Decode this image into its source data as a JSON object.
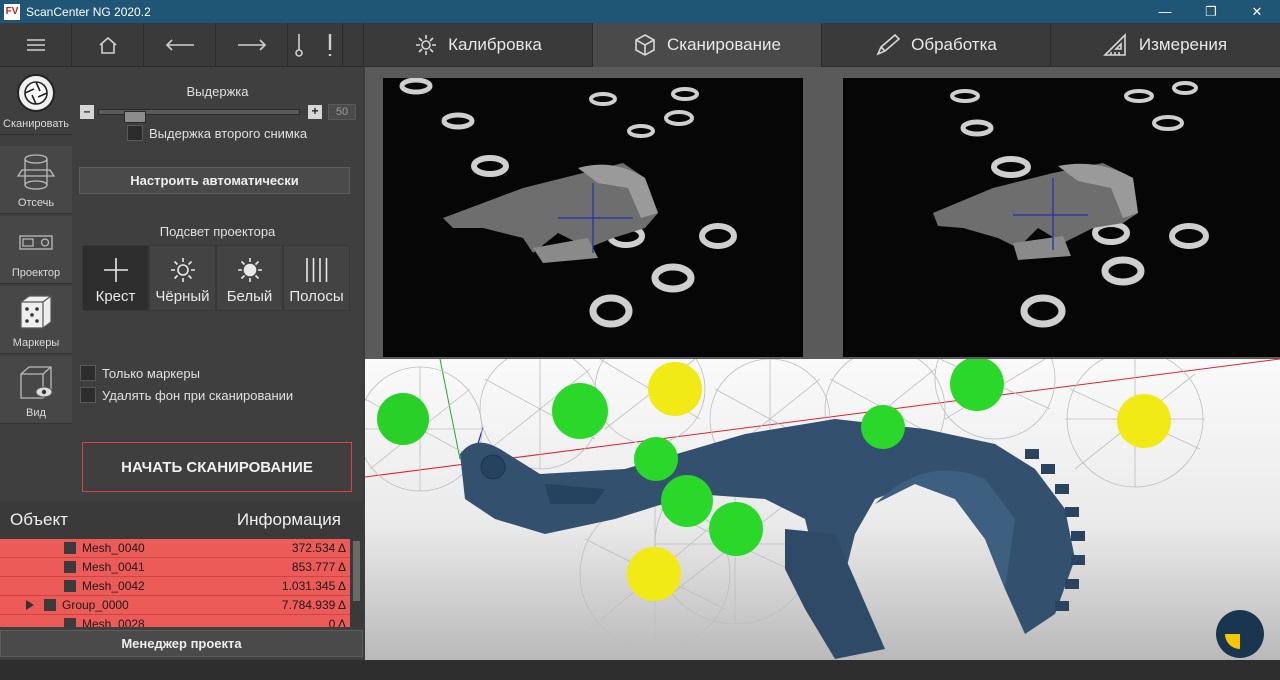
{
  "app": {
    "title": "ScanCenter NG 2020.2",
    "logo": "FV"
  },
  "window": {
    "minimize": "—",
    "restore": "❐",
    "close": "✕"
  },
  "tabs": [
    {
      "label": "Калибровка"
    },
    {
      "label": "Сканирование"
    },
    {
      "label": "Обработка"
    },
    {
      "label": "Измерения"
    }
  ],
  "sidebar": {
    "scan": "Сканировать",
    "clip": "Отсечь",
    "projector": "Проектор",
    "markers": "Маркеры",
    "view": "Вид"
  },
  "exposure": {
    "label": "Выдержка",
    "minus": "–",
    "plus": "+",
    "value": "50",
    "second_shot": "Выдержка второго снимка"
  },
  "auto_button": "Настроить автоматически",
  "projector_light": {
    "label": "Подсвет проектора",
    "modes": [
      "Крест",
      "Чёрный",
      "Белый",
      "Полосы"
    ]
  },
  "options": {
    "markers_only": "Только маркеры",
    "remove_bg": "Удалять фон при сканировании"
  },
  "start_button": "НАЧАТЬ СКАНИРОВАНИЕ",
  "objects": {
    "col_object": "Объект",
    "col_info": "Информация",
    "rows": [
      {
        "name": "Mesh_0040",
        "value": "372.534 Δ"
      },
      {
        "name": "Mesh_0041",
        "value": "853.777 Δ"
      },
      {
        "name": "Mesh_0042",
        "value": "1.031.345 Δ"
      },
      {
        "name": "Group_0000",
        "value": "7.784.939 Δ"
      },
      {
        "name": "Mesh_0028",
        "value": "0 Δ"
      }
    ]
  },
  "project_manager": "Менеджер проекта"
}
